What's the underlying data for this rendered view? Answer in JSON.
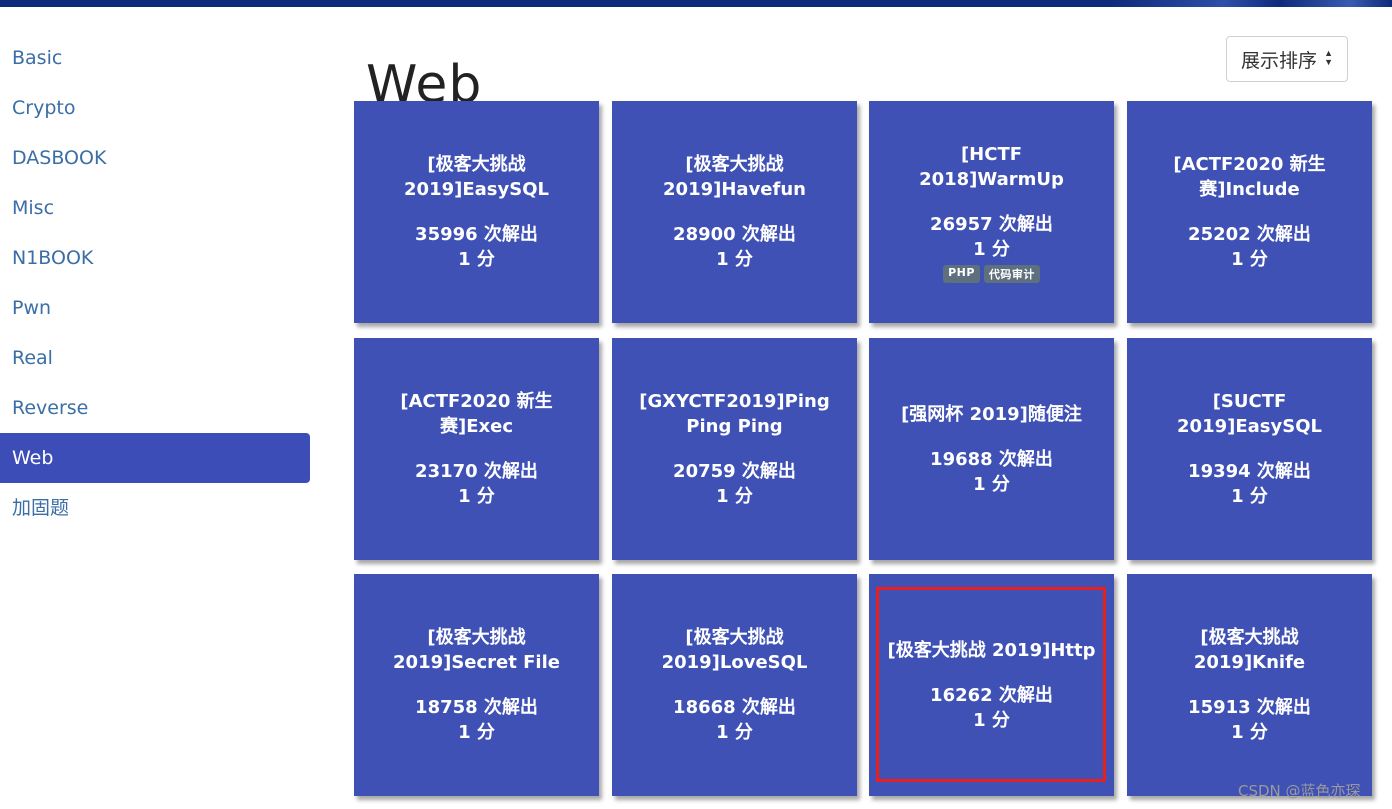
{
  "sidebar": {
    "items": [
      {
        "label": "Basic"
      },
      {
        "label": "Crypto"
      },
      {
        "label": "DASBOOK"
      },
      {
        "label": "Misc"
      },
      {
        "label": "N1BOOK"
      },
      {
        "label": "Pwn"
      },
      {
        "label": "Real"
      },
      {
        "label": "Reverse"
      },
      {
        "label": "Web",
        "active": true
      },
      {
        "label": "加固题"
      }
    ]
  },
  "page": {
    "title": "Web",
    "sort_label": "展示排序"
  },
  "colors": {
    "card_bg": "#3f51b5",
    "active_nav": "#3d4db7",
    "highlight": "#e8201c",
    "top_bar": "#0d2a7a"
  },
  "cards": [
    {
      "title": "[极客大挑战 2019]EasySQL",
      "solves": "35996 次解出",
      "points": "1 分"
    },
    {
      "title": "[极客大挑战 2019]Havefun",
      "solves": "28900 次解出",
      "points": "1 分"
    },
    {
      "title": "[HCTF 2018]WarmUp",
      "solves": "26957 次解出",
      "points": "1 分",
      "tags": [
        "PHP",
        "代码审计"
      ]
    },
    {
      "title": "[ACTF2020 新生赛]Include",
      "solves": "25202 次解出",
      "points": "1 分"
    },
    {
      "title": "[ACTF2020 新生赛]Exec",
      "solves": "23170 次解出",
      "points": "1 分"
    },
    {
      "title": "[GXYCTF2019]Ping Ping Ping",
      "solves": "20759 次解出",
      "points": "1 分"
    },
    {
      "title": "[强网杯 2019]随便注",
      "solves": "19688 次解出",
      "points": "1 分"
    },
    {
      "title": "[SUCTF 2019]EasySQL",
      "solves": "19394 次解出",
      "points": "1 分"
    },
    {
      "title": "[极客大挑战 2019]Secret File",
      "solves": "18758 次解出",
      "points": "1 分"
    },
    {
      "title": "[极客大挑战 2019]LoveSQL",
      "solves": "18668 次解出",
      "points": "1 分"
    },
    {
      "title": "[极客大挑战 2019]Http",
      "solves": "16262 次解出",
      "points": "1 分",
      "highlighted": true
    },
    {
      "title": "[极客大挑战 2019]Knife",
      "solves": "15913 次解出",
      "points": "1 分"
    }
  ],
  "watermark": "CSDN @蓝色亦琛"
}
